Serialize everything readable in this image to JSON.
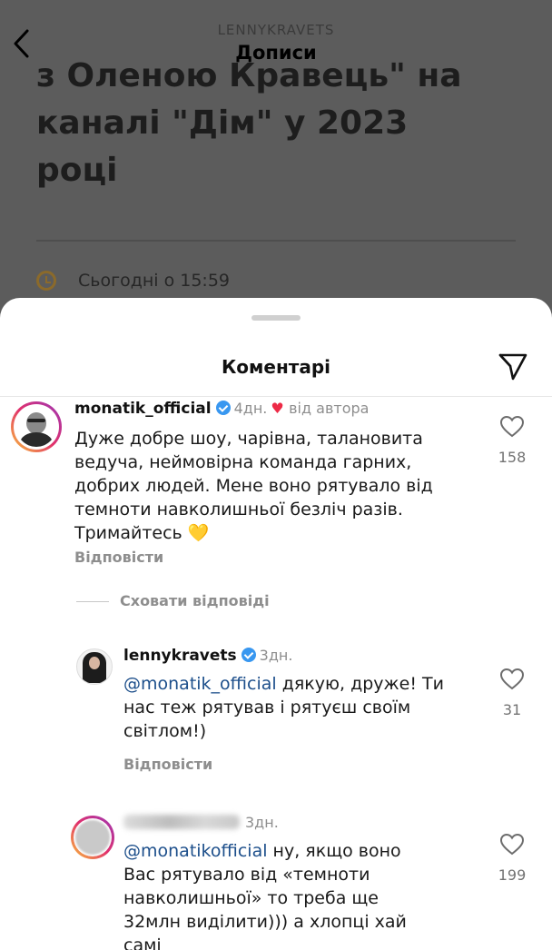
{
  "post": {
    "account": "LENNYKRAVETS",
    "section": "Дописи",
    "headline_lines": "з Оленою Кравець\" на\nканалі \"Дім\" у 2023\nроці",
    "time": "Сьогодні о 15:59"
  },
  "sheet": {
    "title": "Коментарі"
  },
  "comments": [
    {
      "username": "monatik_official",
      "time": "4дн.",
      "author_badge": "від автора",
      "text": "Дуже добре шоу, чарівна, талановита ведуча, неймовірна команда гарних, добрих людей. Мене воно рятувало від темноти навколишньої безліч разів. Тримайтесь 💛",
      "likes": "158",
      "reply_label": "Відповісти",
      "hide_replies_label": "Сховати відповіді"
    },
    {
      "username": "lennykravets",
      "time": "3дн.",
      "mention": "@monatik_official",
      "text": " дякую, друже! Ти нас теж рятував і рятуєш своїм світлом!)",
      "likes": "31",
      "reply_label": "Відповісти"
    },
    {
      "time": "3дн.",
      "mention": "@monatikofficial",
      "text": " ну, якщо воно Вас рятувало від «темноти навколишньої» то треба ще 32млн виділити))) а хлопці хай самі",
      "likes": "199"
    }
  ],
  "colors": {
    "accent_blue": "#3897f0",
    "heart_red": "#ed2a46",
    "mention_blue": "#1d4f8b"
  }
}
